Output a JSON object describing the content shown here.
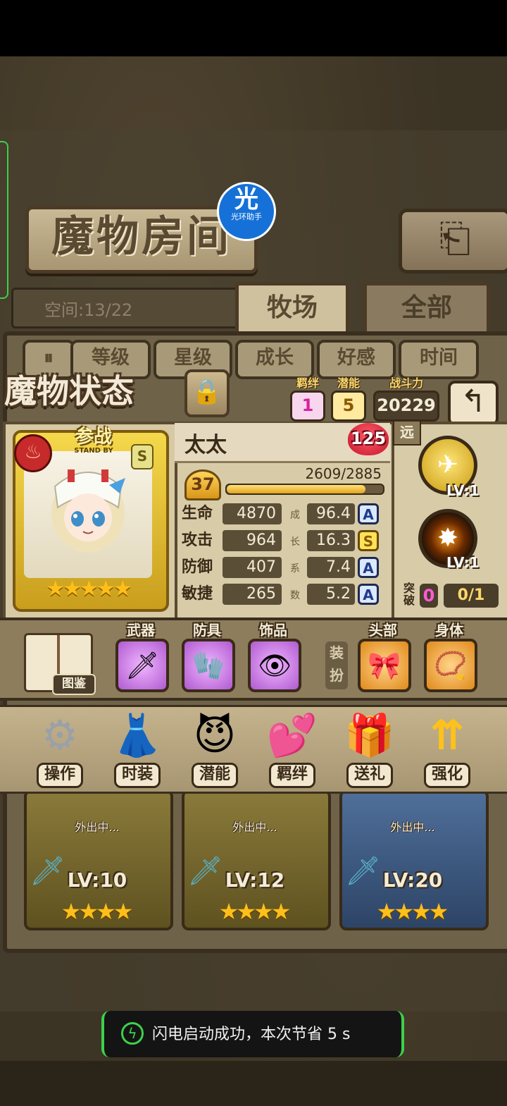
{
  "header": {
    "room_title": "魔物房间",
    "return_icon": "return-arrow-icon",
    "assistant_badge": {
      "glyph": "光",
      "label": "光环助手"
    },
    "space": "空间:13/22",
    "tabs": [
      {
        "label": "牧场",
        "active": true
      },
      {
        "label": "全部",
        "active": false
      }
    ],
    "sort_buttons": [
      "等级",
      "星级",
      "成长",
      "好感",
      "时间"
    ],
    "pause_glyph": "⏸"
  },
  "status": {
    "title": "魔物状态",
    "lock_icon": "padlock-icon",
    "bond": {
      "label": "羁绊",
      "value": "1",
      "color": "#ff6ad4"
    },
    "potential": {
      "label": "潜能",
      "value": "5",
      "color": "#ffb400"
    },
    "power": {
      "label": "战斗力",
      "value": "20229"
    },
    "back_icon": "back-arrow-icon"
  },
  "character": {
    "standby_text": "参战",
    "standby_sub": "STAND BY",
    "rank": "S",
    "element_icon": "fire-icon",
    "stars": 5,
    "name": "太太",
    "affinity": "125",
    "level": "37",
    "exp_text": "2609/2885",
    "exp_fraction": 0.904
  },
  "stats": {
    "growth_vertical": [
      "成",
      "长",
      "系",
      "数"
    ],
    "rows": [
      {
        "label": "生命",
        "value": "4870",
        "growth": "96.4",
        "grade": "A"
      },
      {
        "label": "攻击",
        "value": "964",
        "growth": "16.3",
        "grade": "S"
      },
      {
        "label": "防御",
        "value": "407",
        "growth": "7.4",
        "grade": "A"
      },
      {
        "label": "敏捷",
        "value": "265",
        "growth": "5.2",
        "grade": "A"
      }
    ]
  },
  "skills": {
    "range": "远",
    "list": [
      {
        "name": "aircraft-skill-icon",
        "level": "LV:1"
      },
      {
        "name": "explosion-skill-icon",
        "level": "LV:1"
      }
    ],
    "breakthrough_label": "突破",
    "breakthrough_count": "0",
    "breakthrough_progress": "0/1"
  },
  "equipment": {
    "book_label": "图鉴",
    "equip_vertical": "装扮",
    "slots": [
      {
        "label": "武器",
        "icon": "sword-weapon-icon",
        "glyph": "🗡"
      },
      {
        "label": "防具",
        "icon": "armor-icon",
        "glyph": "🧤"
      },
      {
        "label": "饰品",
        "icon": "eye-amulet-icon",
        "glyph": "👁"
      },
      {
        "label": "头部",
        "icon": "hair-ribbon-icon",
        "glyph": "🎀"
      },
      {
        "label": "身体",
        "icon": "necklace-icon",
        "glyph": "📿"
      }
    ]
  },
  "actions": [
    {
      "label": "操作",
      "icon": "gear-icon",
      "glyph": "⚙"
    },
    {
      "label": "时装",
      "icon": "outfit-icon",
      "glyph": "👗"
    },
    {
      "label": "潜能",
      "icon": "demon-icon",
      "glyph": "😈"
    },
    {
      "label": "羁绊",
      "icon": "hearts-icon",
      "glyph": "💕"
    },
    {
      "label": "送礼",
      "icon": "gift-icon",
      "glyph": "🎁"
    },
    {
      "label": "强化",
      "icon": "upgrade-arrows-icon",
      "glyph": "⇈"
    }
  ],
  "monsters": [
    {
      "level": "LV:10",
      "status": "外出中...",
      "stars": "★★★★"
    },
    {
      "level": "LV:12",
      "status": "外出中...",
      "stars": "★★★★"
    },
    {
      "level": "LV:20",
      "status": "外出中...",
      "stars": "★★★★"
    }
  ],
  "toast": {
    "text": "闪电启动成功，本次节省 5 s",
    "icon": "lightning-icon"
  }
}
